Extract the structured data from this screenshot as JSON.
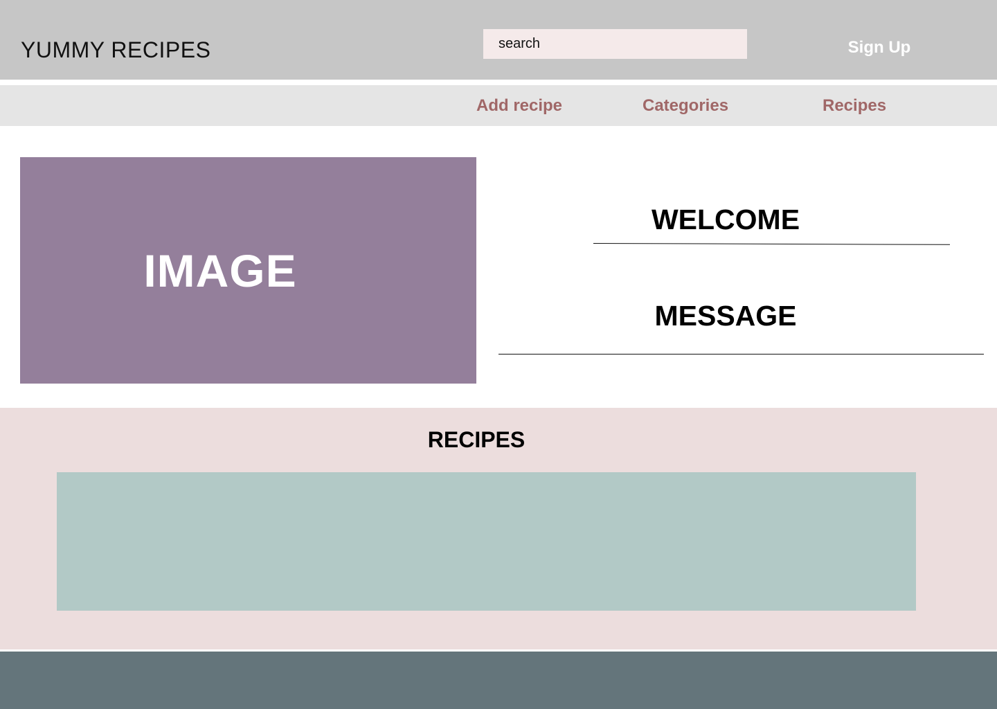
{
  "header": {
    "logo": "YUMMY RECIPES",
    "search_placeholder": "search",
    "signup_label": "Sign Up"
  },
  "nav": {
    "items": [
      {
        "label": "Add recipe"
      },
      {
        "label": "Categories"
      },
      {
        "label": "Recipes"
      }
    ]
  },
  "hero": {
    "image_label": "IMAGE",
    "welcome": "WELCOME",
    "message": "MESSAGE"
  },
  "recipes": {
    "title": "RECIPES"
  },
  "colors": {
    "header_bg": "#c6c6c6",
    "nav_bg": "#e5e5e5",
    "nav_link": "#a06767",
    "image_placeholder": "#947f9b",
    "recipes_bg": "#ecdddd",
    "recipes_box": "#b2c9c6",
    "footer_bg": "#64757b"
  }
}
